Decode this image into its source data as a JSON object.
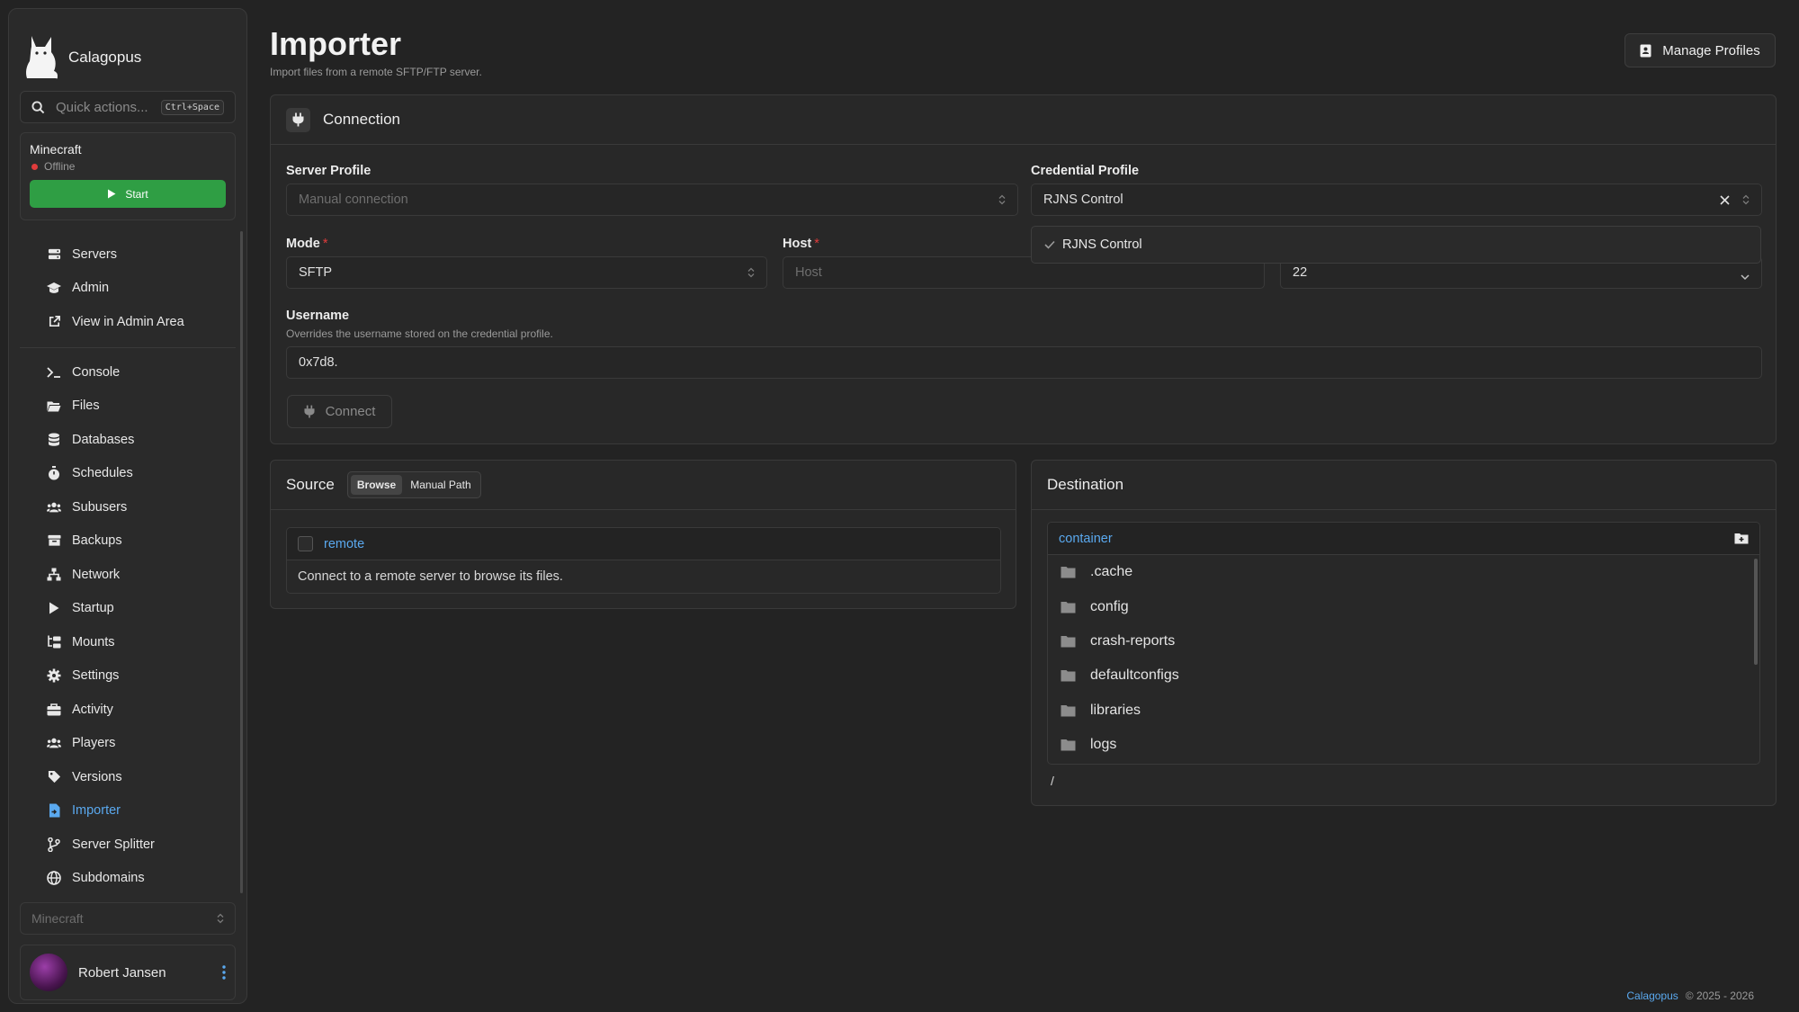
{
  "app": {
    "name": "Calagopus"
  },
  "search": {
    "placeholder": "Quick actions...",
    "shortcut": "Ctrl+Space"
  },
  "server": {
    "name": "Minecraft",
    "status": "Offline",
    "start_label": "Start",
    "status_color": "#e03c3c",
    "start_color": "#2f9e44"
  },
  "nav_top": [
    {
      "label": "Servers",
      "icon": "server-stack-icon"
    },
    {
      "label": "Admin",
      "icon": "graduation-cap-icon"
    },
    {
      "label": "View in Admin Area",
      "icon": "external-link-icon"
    }
  ],
  "nav_server": [
    {
      "label": "Console",
      "icon": "terminal-icon"
    },
    {
      "label": "Files",
      "icon": "folder-open-icon"
    },
    {
      "label": "Databases",
      "icon": "database-icon"
    },
    {
      "label": "Schedules",
      "icon": "stopwatch-icon"
    },
    {
      "label": "Subusers",
      "icon": "users-icon"
    },
    {
      "label": "Backups",
      "icon": "archive-icon"
    },
    {
      "label": "Network",
      "icon": "network-icon"
    },
    {
      "label": "Startup",
      "icon": "play-icon"
    },
    {
      "label": "Mounts",
      "icon": "folder-tree-icon"
    },
    {
      "label": "Settings",
      "icon": "gear-icon"
    },
    {
      "label": "Activity",
      "icon": "briefcase-icon"
    },
    {
      "label": "Players",
      "icon": "users-icon"
    },
    {
      "label": "Versions",
      "icon": "tag-icon"
    },
    {
      "label": "Importer",
      "icon": "file-import-icon",
      "active": true
    },
    {
      "label": "Server Splitter",
      "icon": "code-branch-icon"
    },
    {
      "label": "Subdomains",
      "icon": "globe-icon"
    }
  ],
  "server_select": {
    "value": "Minecraft"
  },
  "user": {
    "name": "Robert Jansen"
  },
  "page": {
    "title": "Importer",
    "subtitle": "Import files from a remote SFTP/FTP server.",
    "manage_label": "Manage Profiles"
  },
  "connection": {
    "title": "Connection",
    "server_profile": {
      "label": "Server Profile",
      "placeholder": "Manual connection"
    },
    "credential_profile": {
      "label": "Credential Profile",
      "value": "RJNS Control",
      "options": [
        "RJNS Control"
      ]
    },
    "mode": {
      "label": "Mode",
      "value": "SFTP"
    },
    "host": {
      "label": "Host",
      "placeholder": "Host"
    },
    "port": {
      "value": "22"
    },
    "username": {
      "label": "Username",
      "hint": "Overrides the username stored on the credential profile.",
      "value": "0x7d8."
    },
    "connect_label": "Connect"
  },
  "source": {
    "title": "Source",
    "tabs": [
      "Browse",
      "Manual Path"
    ],
    "root": "remote",
    "empty": "Connect to a remote server to browse its files."
  },
  "destination": {
    "title": "Destination",
    "root": "container",
    "folders": [
      ".cache",
      "config",
      "crash-reports",
      "defaultconfigs",
      "libraries",
      "logs"
    ],
    "path": "/"
  },
  "footer": {
    "brand": "Calagopus",
    "copyright": "© 2025 - 2026"
  },
  "colors": {
    "accent": "#5aa9ef",
    "background": "#232323",
    "card": "#282828"
  }
}
